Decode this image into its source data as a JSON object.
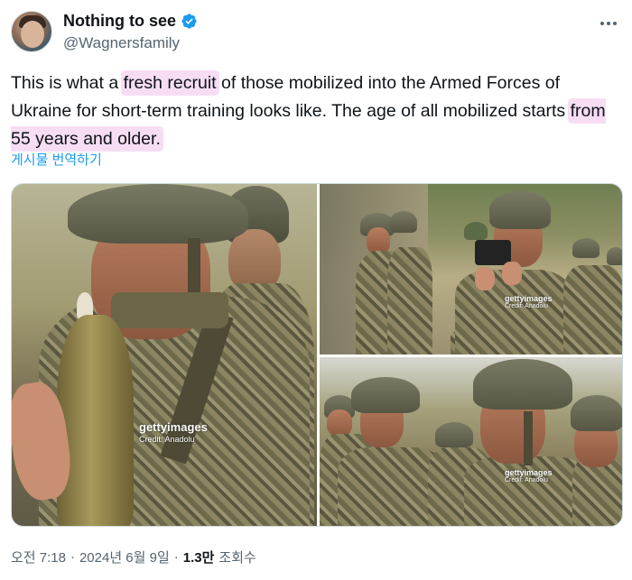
{
  "author": {
    "display_name": "Nothing to see",
    "handle": "@Wagnersfamily",
    "verified": true,
    "verified_color": "#1d9bf0"
  },
  "tweet": {
    "text_parts": [
      {
        "text": "This is what a ",
        "highlight": false
      },
      {
        "text": "fresh recruit",
        "highlight": true
      },
      {
        "text": " of those mobilized into the Armed Forces of Ukraine for short-term training looks like. The age of all mobilized starts ",
        "highlight": false
      },
      {
        "text": "from 55 years and older.",
        "highlight": true
      }
    ],
    "highlight_color": "#f7ddf4",
    "translate_label": "게시물 번역하기"
  },
  "media": {
    "photos": [
      {
        "watermark_brand": "gettyimages",
        "watermark_credit": "Credit: Anadolu"
      },
      {
        "watermark_brand": "gettyimages",
        "watermark_credit": "Credit: Anadolu"
      },
      {
        "watermark_brand": "gettyimages",
        "watermark_credit": "Credit: Anadolu"
      }
    ]
  },
  "meta": {
    "time": "오전 7:18",
    "separator": "·",
    "date": "2024년 6월 9일",
    "views_count": "1.3만",
    "views_label": "조회수"
  },
  "icons": {
    "more": "more-options-icon",
    "verified": "verified-badge-icon"
  },
  "colors": {
    "link": "#1d9bf0",
    "secondary_text": "#536471",
    "primary_text": "#0f1419"
  }
}
